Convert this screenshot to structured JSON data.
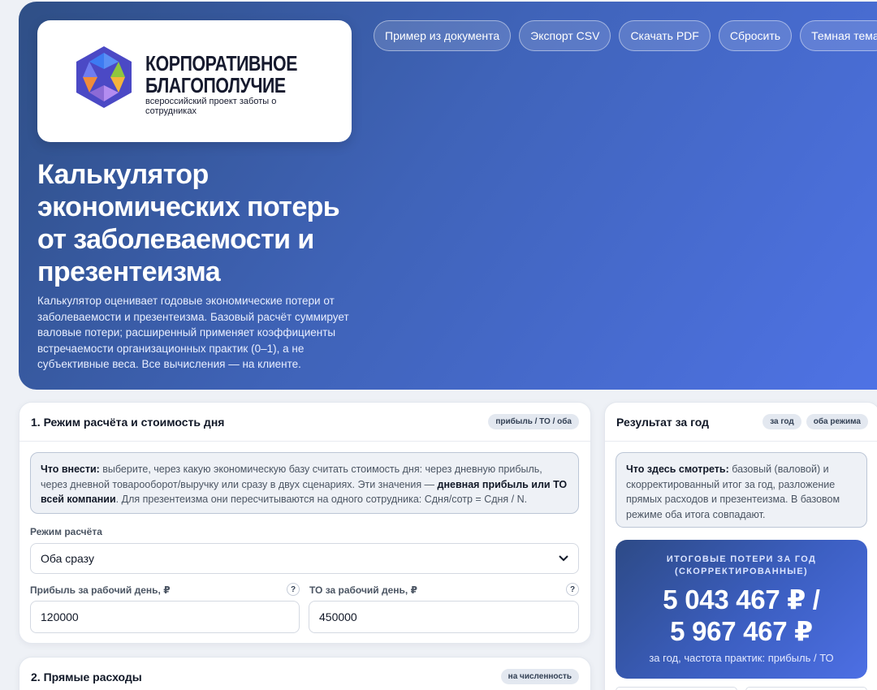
{
  "brand": {
    "name_line1": "КОРПОРАТИВНОЕ",
    "name_line2": "БЛАГОПОЛУЧИЕ",
    "tagline": "всероссийский проект заботы о сотрудниках",
    "colors": {
      "blue": "#3d7bf2",
      "green": "#8fc63e",
      "yellow": "#f4b43a",
      "purple": "#8c6ad6",
      "orange": "#f08c3a",
      "indigo": "#4b49c5"
    }
  },
  "toolbar": {
    "example": "Пример из документа",
    "export_csv": "Экспорт CSV",
    "download_pdf": "Скачать PDF",
    "reset": "Сбросить",
    "dark_theme": "Темная тема"
  },
  "hero": {
    "title": "Калькулятор экономических потерь от заболеваемости и презентеизма",
    "description": "Калькулятор оценивает годовые экономические потери от заболеваемости и презентеизма. Базовый расчёт суммирует валовые потери; расширенный применяет коэффициенты встречаемости организационных практик (0–1), а не субъективные веса. Все вычисления — на клиенте."
  },
  "section1": {
    "title": "1. Режим расчёта и стоимость дня",
    "badge": "прибыль / ТО / оба",
    "info_lead": "Что внести:",
    "info_text1": " выберите, через какую экономическую базу считать стоимость дня: через дневную прибыль, через дневной товарооборот/выручку или сразу в двух сценариях. Эти значения — ",
    "info_bold": "дневная прибыль или ТО всей компании",
    "info_text2": ". Для презентеизма они пересчитываются на одного сотрудника: Сдня/сотр = Сдня / N.",
    "mode_label": "Режим расчёта",
    "mode_value": "Оба сразу",
    "profit_label": "Прибыль за рабочий день, ₽",
    "profit_value": "120000",
    "turnover_label": "ТО за рабочий день, ₽",
    "turnover_value": "450000",
    "help": "?"
  },
  "section2": {
    "title": "2. Прямые расходы",
    "badge": "на численность"
  },
  "result": {
    "title": "Результат за год",
    "badge1": "за год",
    "badge2": "оба режима",
    "info_lead": "Что здесь смотреть:",
    "info_text": " базовый (валовой) и скорректированный итог за год, разложение прямых расходов и презентеизма. В базовом режиме оба итога совпадают.",
    "total_label": "ИТОГОВЫЕ ПОТЕРИ ЗА ГОД (СКОРРЕКТИРОВАННЫЕ)",
    "total_value_line1": "5 043 467 ₽ /",
    "total_value_line2": "5 967 467 ₽",
    "total_note": "за год, частота практик: прибыль / ТО"
  }
}
